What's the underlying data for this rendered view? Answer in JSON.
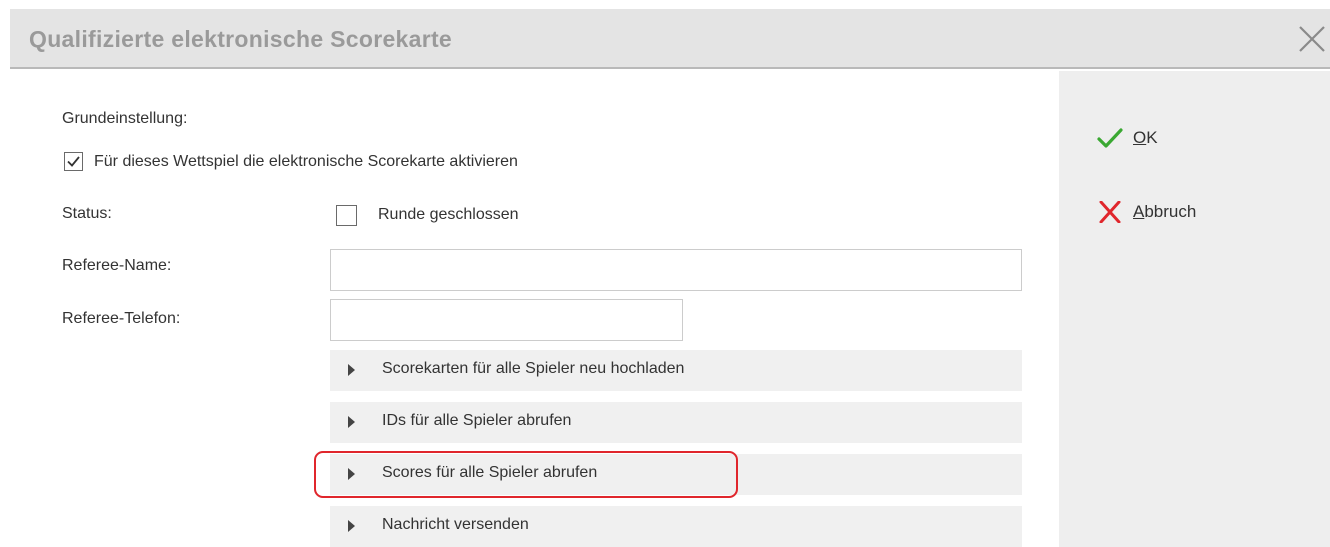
{
  "dialog": {
    "title": "Qualifizierte elektronische Scorekarte"
  },
  "form": {
    "section_label": "Grundeinstellung:",
    "activate_checkbox": {
      "label": "Für dieses Wettspiel die elektronische Scorekarte aktivieren",
      "checked": true
    },
    "status_label": "Status:",
    "round_closed_checkbox": {
      "label": "Runde geschlossen",
      "checked": false
    },
    "referee_name_label": "Referee-Name:",
    "referee_name_value": "",
    "referee_phone_label": "Referee-Telefon:",
    "referee_phone_value": ""
  },
  "actions": [
    {
      "label": "Scorekarten für alle Spieler neu hochladen"
    },
    {
      "label": "IDs für alle Spieler abrufen"
    },
    {
      "label": "Scores für alle Spieler abrufen",
      "highlighted": true
    },
    {
      "label": "Nachricht versenden"
    }
  ],
  "side_buttons": {
    "ok": {
      "mnemonic": "O",
      "rest": "K",
      "icon": "checkmark-icon",
      "color": "#3aa832"
    },
    "cancel": {
      "mnemonic": "A",
      "rest": "bbruch",
      "icon": "x-icon",
      "color": "#e0262c"
    }
  }
}
